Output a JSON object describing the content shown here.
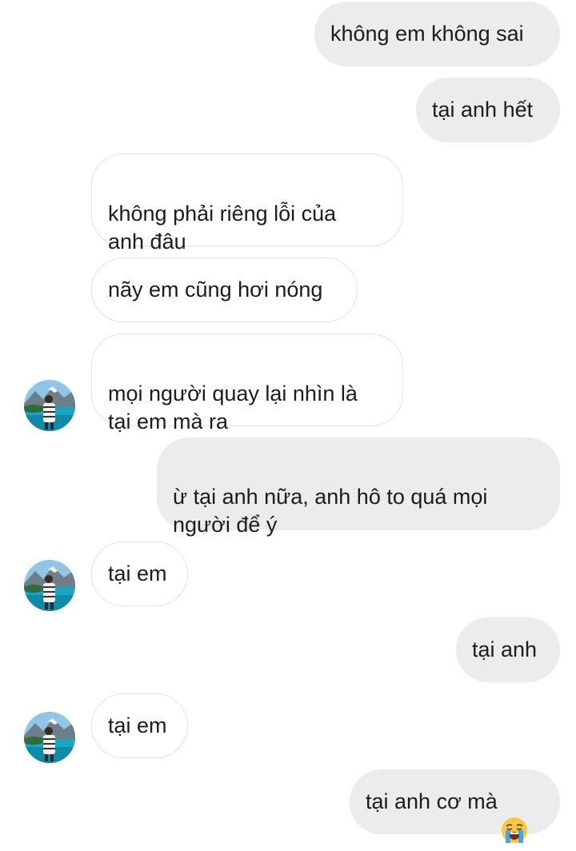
{
  "messages": [
    {
      "id": "m1",
      "direction": "sent",
      "text": "không em không sai"
    },
    {
      "id": "m2",
      "direction": "sent",
      "text": "tại anh hết"
    },
    {
      "id": "m3",
      "direction": "received",
      "text": "không phải riêng lỗi của\nanh đâu"
    },
    {
      "id": "m4",
      "direction": "received",
      "text": "nãy em cũng hơi nóng"
    },
    {
      "id": "m5",
      "direction": "received",
      "text": "mọi người quay lại nhìn là\ntại em mà ra"
    },
    {
      "id": "m6",
      "direction": "sent",
      "text": "ừ tại anh nữa, anh hô to quá mọi\nngười để ý"
    },
    {
      "id": "m7",
      "direction": "received",
      "text": "tại em"
    },
    {
      "id": "m8",
      "direction": "sent",
      "text": "tại anh"
    },
    {
      "id": "m9",
      "direction": "received",
      "text": "tại em"
    },
    {
      "id": "m10",
      "direction": "sent",
      "text": "tại anh cơ mà",
      "emoji": "loudly-crying-face-emoji"
    }
  ],
  "colors": {
    "sent_bubble": "#ececec",
    "received_border": "#e3e3e3",
    "text": "#1c1c1c"
  }
}
